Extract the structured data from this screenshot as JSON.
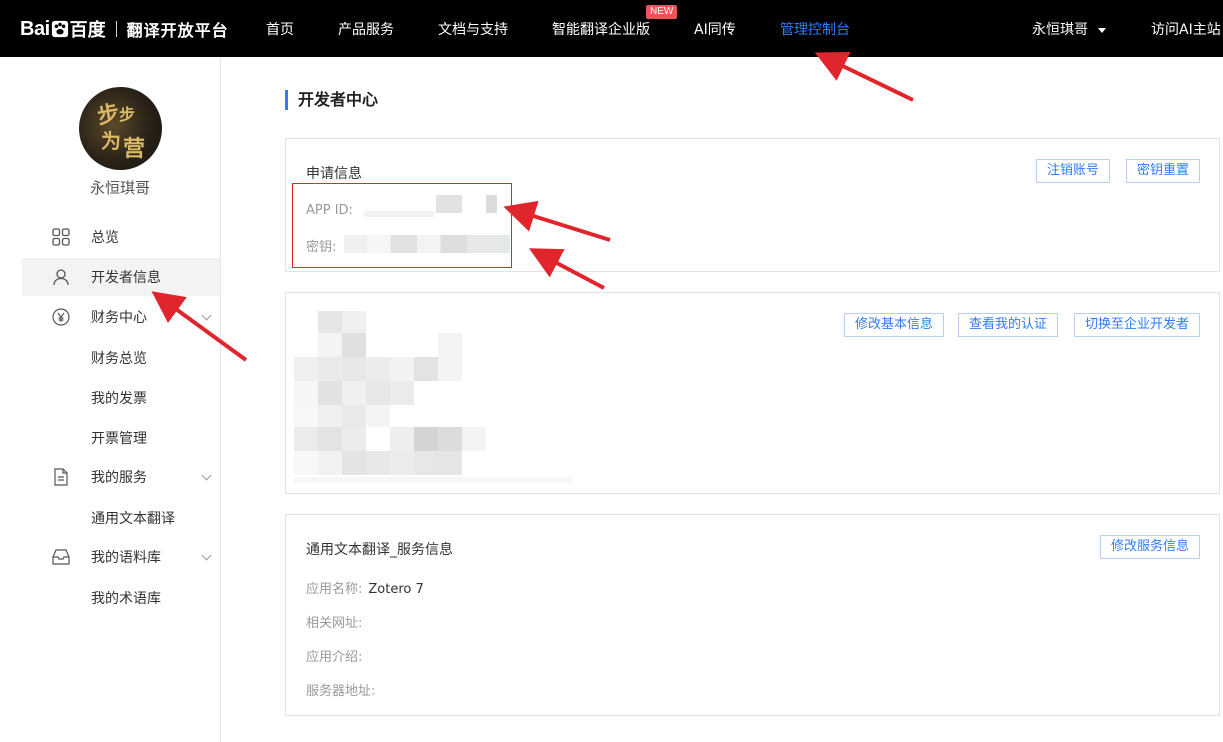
{
  "topbar": {
    "logo_bai": "Bai",
    "logo_du": "百度",
    "logo_sub": "翻译开放平台",
    "nav": [
      {
        "label": "首页"
      },
      {
        "label": "产品服务"
      },
      {
        "label": "文档与支持"
      },
      {
        "label": "智能翻译企业版"
      },
      {
        "label": "AI同传"
      },
      {
        "label": "管理控制台"
      }
    ],
    "new_badge": "NEW",
    "user_name": "永恒琪哥",
    "visit_ai": "访问AI主站"
  },
  "sidebar": {
    "username": "永恒琪哥",
    "menu": [
      {
        "label": "总览",
        "icon": "grid-icon"
      },
      {
        "label": "开发者信息",
        "icon": "user-icon"
      },
      {
        "label": "财务中心",
        "icon": "yen-icon"
      },
      {
        "label": "财务总览"
      },
      {
        "label": "我的发票"
      },
      {
        "label": "开票管理"
      },
      {
        "label": "我的服务",
        "icon": "document-icon"
      },
      {
        "label": "通用文本翻译"
      },
      {
        "label": "我的语料库",
        "icon": "inbox-icon"
      },
      {
        "label": "我的术语库"
      }
    ]
  },
  "main": {
    "title": "开发者中心",
    "apply_card": {
      "title": "申请信息",
      "btn_cancel": "注销账号",
      "btn_reset": "密钥重置",
      "appid_label": "APP ID:",
      "secret_label": "密钥:"
    },
    "profile_card": {
      "btn_edit": "修改基本信息",
      "btn_cert": "查看我的认证",
      "btn_switch": "切换至企业开发者"
    },
    "service_card": {
      "title": "通用文本翻译_服务信息",
      "btn_edit": "修改服务信息",
      "app_name_label": "应用名称:",
      "app_name_value": "Zotero 7",
      "url_label": "相关网址:",
      "intro_label": "应用介绍:",
      "server_label": "服务器地址:"
    }
  },
  "colors": {
    "accent": "#2f7cf6",
    "annotation_red": "#e0262c",
    "topbar_bg": "#000000"
  }
}
